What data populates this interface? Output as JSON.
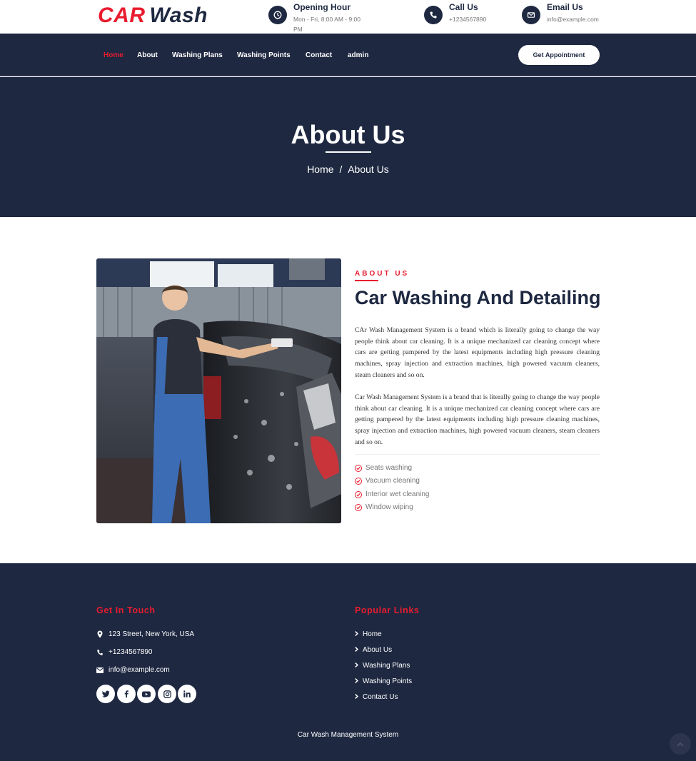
{
  "brand": {
    "part1": "CAR",
    "part2": "Wash",
    "accent_color": "#e81c2e",
    "dark_color": "#1e2841"
  },
  "topbar": {
    "hours": {
      "icon": "clock-icon",
      "title": "Opening Hour",
      "text": "Mon - Fri, 8:00 AM - 9:00 PM"
    },
    "call": {
      "icon": "phone-icon",
      "title": "Call Us",
      "text": "+1234567890"
    },
    "email": {
      "icon": "envelope-icon",
      "title": "Email Us",
      "text": "info@example.com"
    }
  },
  "nav": {
    "items": [
      "Home",
      "About",
      "Washing Plans",
      "Washing Points",
      "Contact",
      "admin"
    ],
    "active": "Home",
    "cta": "Get Appointment"
  },
  "hero": {
    "title": "About Us",
    "crumb_home": "Home",
    "crumb_sep": "/",
    "crumb_current": "About Us"
  },
  "about": {
    "kicker": "ABOUT US",
    "heading": "Car Washing And Detailing",
    "paragraph1": "CAr Wash Management System is a brand which is literally going to change the way people think about car cleaning. It is a unique mechanized car cleaning concept where cars are getting pampered by the latest equipments including high pressure cleaning machines, spray injection and extraction machines, high powered vacuum cleaners, steam cleaners and so on.",
    "paragraph2": "Car Wash  Management System is a brand that is literally going to change the way people think about car cleaning. It is a unique mechanized car cleaning concept where cars are getting pampered by the latest equipments including high pressure cleaning machines, spray injection and extraction machines, high powered vacuum cleaners, steam cleaners and so on.",
    "features": [
      "Seats washing",
      "Vacuum cleaning",
      "Interior wet cleaning",
      "Window wiping"
    ]
  },
  "footer": {
    "touch_heading": "Get In Touch",
    "address": "123 Street, New York, USA",
    "phone": "+1234567890",
    "email": "info@example.com",
    "social": [
      "twitter-icon",
      "facebook-icon",
      "youtube-icon",
      "instagram-icon",
      "linkedin-icon"
    ],
    "links_heading": "Popular Links",
    "links": [
      "Home",
      "About Us",
      "Washing Plans",
      "Washing Points",
      "Contact Us"
    ],
    "copyright": "Car Wash Management System"
  }
}
